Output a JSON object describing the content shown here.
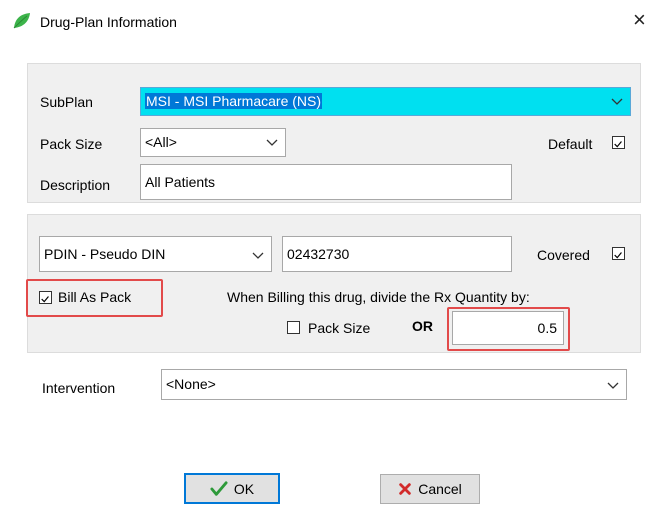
{
  "window": {
    "title": "Drug-Plan Information",
    "close_glyph": "×",
    "icon": "leaf-icon",
    "icon_color": "#3cb44a"
  },
  "plan": {
    "subplan_label": "SubPlan",
    "subplan_value": "MSI - MSI Pharmacare (NS)",
    "subplan_highlight": "#00e0f0",
    "packsize_label": "Pack Size",
    "packsize_value": "<All>",
    "default_label": "Default",
    "default_checked": true,
    "description_label": "Description",
    "description_value": "All Patients"
  },
  "billing": {
    "din_type_value": "PDIN - Pseudo DIN",
    "din_value": "02432730",
    "covered_label": "Covered",
    "covered_checked": true,
    "bill_as_pack_label": "Bill As Pack",
    "bill_as_pack_checked": true,
    "divide_text": "When Billing this drug, divide the Rx Quantity by:",
    "packsize_check_label": "Pack Size",
    "packsize_checked": false,
    "or_label": "OR",
    "quantity_value": "0.5",
    "highlight_color": "#e24a4a"
  },
  "intervention": {
    "label": "Intervention",
    "value": "<None>"
  },
  "buttons": {
    "ok_label": "OK",
    "cancel_label": "Cancel",
    "ok_icon": "checkmark-icon",
    "cancel_icon": "x-icon"
  }
}
